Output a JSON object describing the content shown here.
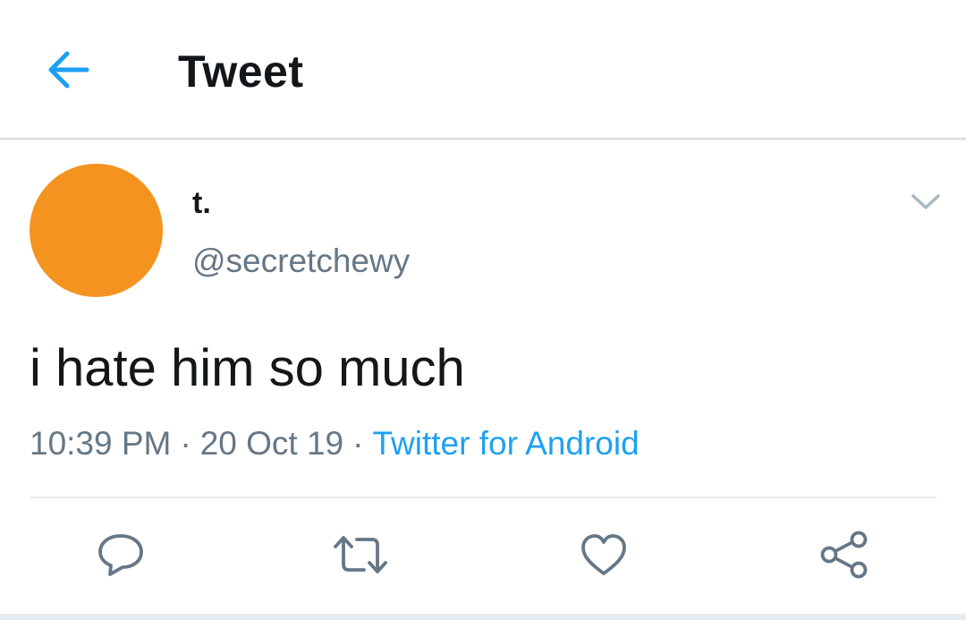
{
  "colors": {
    "accent": "#1da1f2",
    "avatar": "#f4931f",
    "text_primary": "#14171a",
    "text_secondary": "#657786"
  },
  "header": {
    "back_icon": "arrow-left-icon",
    "title": "Tweet"
  },
  "tweet": {
    "author": {
      "display_name": "t.",
      "handle": "@secretchewy"
    },
    "menu_icon": "chevron-down-icon",
    "text": "i hate him so much",
    "time": "10:39 PM",
    "date": "20 Oct 19",
    "source": "Twitter for Android",
    "separator": "·"
  },
  "actions": [
    {
      "name": "reply",
      "icon": "reply-icon"
    },
    {
      "name": "retweet",
      "icon": "retweet-icon"
    },
    {
      "name": "like",
      "icon": "heart-icon"
    },
    {
      "name": "share",
      "icon": "share-icon"
    }
  ]
}
